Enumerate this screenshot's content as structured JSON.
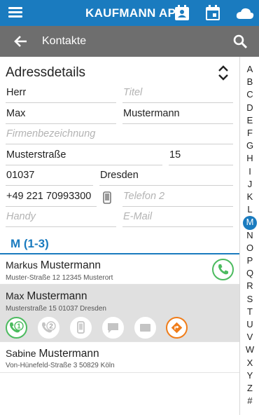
{
  "topbar": {
    "brand": "KAUFMANN AP",
    "icons": [
      "menu-icon",
      "contact-card-icon",
      "calendar-icon",
      "cloud-icon"
    ]
  },
  "toolbar": {
    "title": "Kontakte"
  },
  "address": {
    "title": "Adressdetails",
    "salutation": "Herr",
    "title_placeholder": "Titel",
    "first_name": "Max",
    "last_name": "Mustermann",
    "company_placeholder": "Firmenbezeichnung",
    "street": "Musterstraße",
    "house_number": "15",
    "zip": "01037",
    "city": "Dresden",
    "phone1": "+49 221 70993300",
    "phone2_placeholder": "Telefon 2",
    "mobile_placeholder": "Handy",
    "email_placeholder": "E-Mail"
  },
  "group": {
    "label": "M (1-3)"
  },
  "contacts": [
    {
      "first": "Markus",
      "last": "Mustermann",
      "address": "Muster-Straße 12 12345 Musterort"
    },
    {
      "first": "Max",
      "last": "Mustermann",
      "address": "Musterstraße 15 01037 Dresden"
    },
    {
      "first": "Sabine",
      "last": "Mustermann",
      "address": "Von-Hünefeld-Straße 3 50829 Köln"
    }
  ],
  "action_labels": {
    "call1": "1",
    "call2": "2"
  },
  "colors": {
    "primary": "#1a7bbf",
    "green": "#4cbb5f",
    "orange": "#f07d1a",
    "toolbar": "#6e6e6e"
  },
  "alphabet": [
    "A",
    "B",
    "C",
    "D",
    "E",
    "F",
    "G",
    "H",
    "I",
    "J",
    "K",
    "L",
    "M",
    "N",
    "O",
    "P",
    "Q",
    "R",
    "S",
    "T",
    "U",
    "V",
    "W",
    "X",
    "Y",
    "Z",
    "#"
  ],
  "alphabet_active": "M"
}
